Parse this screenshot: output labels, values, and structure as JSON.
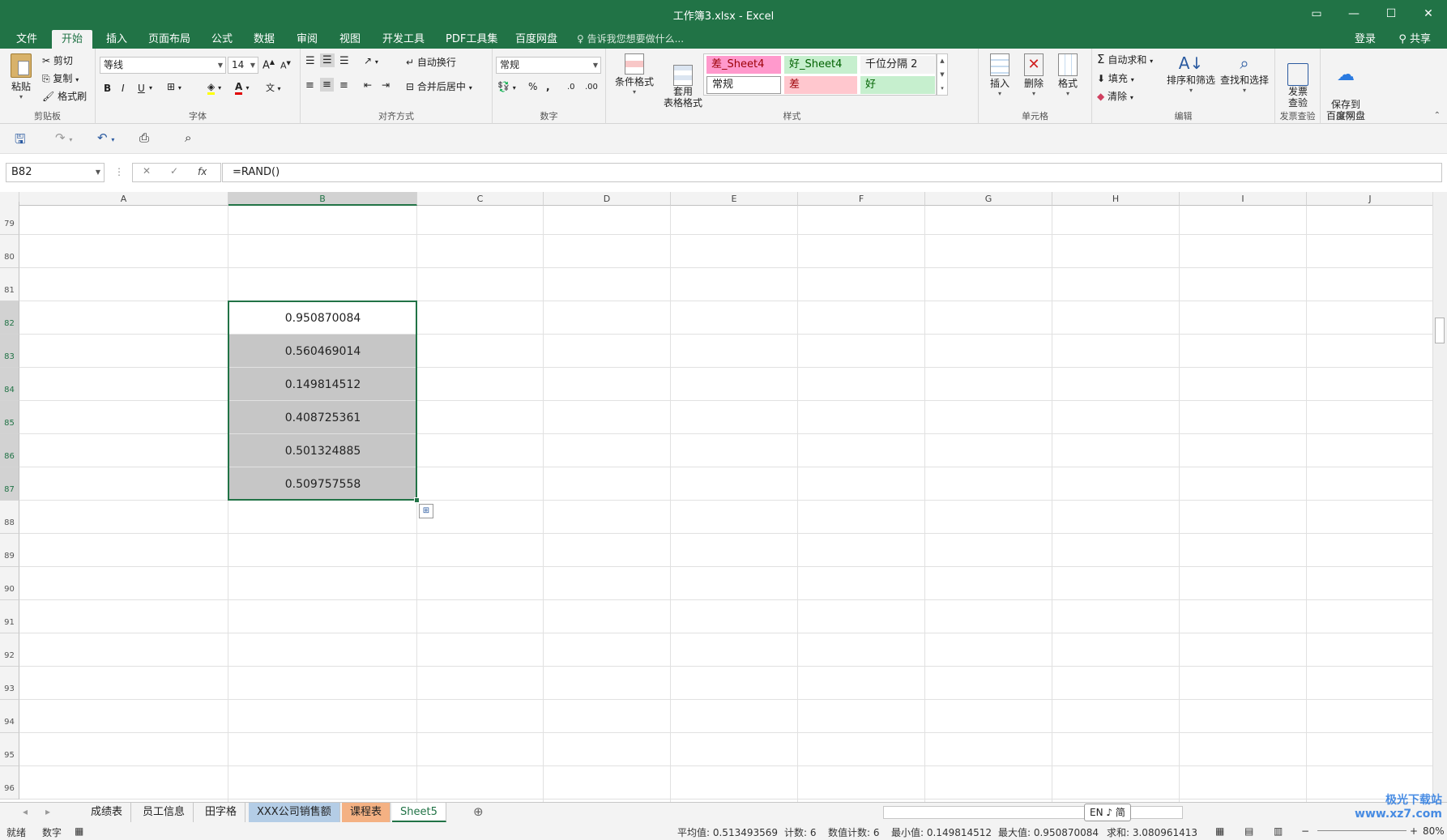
{
  "window": {
    "title": "工作簿3.xlsx - Excel"
  },
  "menu_tabs": [
    "文件",
    "开始",
    "插入",
    "页面布局",
    "公式",
    "数据",
    "审阅",
    "视图",
    "开发工具",
    "PDF工具集",
    "百度网盘"
  ],
  "active_tab": "开始",
  "tell_me": "告诉我您想要做什么...",
  "account": {
    "login": "登录",
    "share": "共享"
  },
  "ribbon": {
    "clipboard": {
      "label": "剪贴板",
      "paste": "粘贴",
      "cut": "剪切",
      "copy": "复制",
      "format_painter": "格式刷"
    },
    "font": {
      "label": "字体",
      "name": "等线",
      "size": "14",
      "bold": "B",
      "italic": "I",
      "underline": "U"
    },
    "alignment": {
      "label": "对齐方式",
      "wrap": "自动换行",
      "merge": "合并后居中"
    },
    "number": {
      "label": "数字",
      "format": "常规",
      "percent": "%",
      "comma": ","
    },
    "styles": {
      "label": "样式",
      "conditional": "条件格式",
      "table": "套用\n表格格式",
      "cells": [
        {
          "text": "差_Sheet4",
          "bg": "#ff99cc",
          "fg": "#9c0006"
        },
        {
          "text": "好_Sheet4",
          "bg": "#c6efce",
          "fg": "#006100"
        },
        {
          "text": "千位分隔 2",
          "bg": "#f3f3f3",
          "fg": "#222222"
        },
        {
          "text": "常规",
          "bg": "#ffffff",
          "fg": "#222222"
        },
        {
          "text": "差",
          "bg": "#ffc7ce",
          "fg": "#9c0006"
        },
        {
          "text": "好",
          "bg": "#c6efce",
          "fg": "#006100"
        }
      ]
    },
    "cells": {
      "label": "单元格",
      "insert": "插入",
      "delete": "删除",
      "format": "格式"
    },
    "editing": {
      "label": "编辑",
      "autosum": "自动求和",
      "fill": "填充",
      "clear": "清除",
      "sort": "排序和筛选",
      "find": "查找和选择"
    },
    "invoice": {
      "label": "发票查验",
      "btn": "发票\n查验"
    },
    "save": {
      "label": "保存",
      "btn": "保存到\n百度网盘"
    }
  },
  "formula_bar": {
    "name_box": "B82",
    "formula": "=RAND()",
    "fx": "fx"
  },
  "columns": [
    "A",
    "B",
    "C",
    "D",
    "E",
    "F",
    "G",
    "H",
    "I",
    "J"
  ],
  "selected_column": "B",
  "rows": [
    "79",
    "80",
    "81",
    "82",
    "83",
    "84",
    "85",
    "86",
    "87",
    "88",
    "89",
    "90",
    "91",
    "92",
    "93",
    "94",
    "95",
    "96"
  ],
  "cells": [
    {
      "row": "82",
      "col": "B",
      "value": "0.950870084"
    },
    {
      "row": "83",
      "col": "B",
      "value": "0.560469014"
    },
    {
      "row": "84",
      "col": "B",
      "value": "0.149814512"
    },
    {
      "row": "85",
      "col": "B",
      "value": "0.408725361"
    },
    {
      "row": "86",
      "col": "B",
      "value": "0.501324885"
    },
    {
      "row": "87",
      "col": "B",
      "value": "0.509757558"
    }
  ],
  "sheets": [
    {
      "name": "成绩表",
      "style": "normal"
    },
    {
      "name": "员工信息",
      "style": "normal"
    },
    {
      "name": "田字格",
      "style": "normal"
    },
    {
      "name": "XXX公司销售额",
      "style": "blue"
    },
    {
      "name": "课程表",
      "style": "orange"
    },
    {
      "name": "Sheet5",
      "style": "active"
    }
  ],
  "ime": "EN ♪ 简",
  "status": {
    "ready": "就绪",
    "mode": "数字",
    "average": "平均值: 0.513493569",
    "count": "计数: 6",
    "numcount": "数值计数: 6",
    "min": "最小值: 0.149814512",
    "max": "最大值: 0.950870084",
    "sum": "求和: 3.080961413",
    "zoom": "80%"
  },
  "watermark": "极光下载站 www.xz7.com"
}
